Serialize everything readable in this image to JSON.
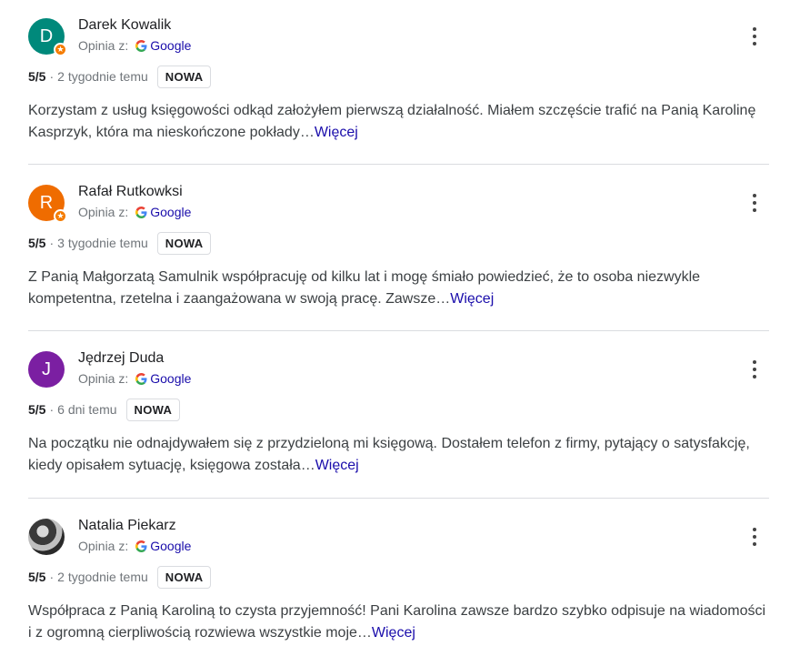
{
  "reviews": [
    {
      "avatar_letter": "D",
      "avatar_color": "#00897b",
      "badge_color": "#f57c00",
      "name": "Darek Kowalik",
      "source_label": "Opinia z:",
      "source_name": "Google",
      "rating": "5/5",
      "date": "2 tygodnie temu",
      "tag": "NOWA",
      "text": "Korzystam z usług księgowości odkąd założyłem pierwszą działalność. Miałem szczęście trafić na Panią Karolinę Kasprzyk, która ma nieskończone pokłady…",
      "more_label": "Więcej"
    },
    {
      "avatar_letter": "R",
      "avatar_color": "#ef6c00",
      "badge_color": "#f57c00",
      "name": "Rafał Rutkowksi",
      "source_label": "Opinia z:",
      "source_name": "Google",
      "rating": "5/5",
      "date": "3 tygodnie temu",
      "tag": "NOWA",
      "text": "Z Panią Małgorzatą Samulnik współpracuję od kilku lat i mogę śmiało powiedzieć, że to osoba niezwykle kompetentna, rzetelna i zaangażowana w swoją pracę. Zawsze…",
      "more_label": "Więcej"
    },
    {
      "avatar_letter": "J",
      "avatar_color": "#7b1fa2",
      "name": "Jędrzej Duda",
      "source_label": "Opinia z:",
      "source_name": "Google",
      "rating": "5/5",
      "date": "6 dni temu",
      "tag": "NOWA",
      "text": "Na początku nie odnajdywałem się z przydzieloną mi księgową. Dostałem telefon z firmy, pytający o satysfakcję, kiedy opisałem sytuację, księgowa została…",
      "more_label": "Więcej"
    },
    {
      "avatar_letter": "",
      "avatar_color": "#555555",
      "name": "Natalia Piekarz",
      "source_label": "Opinia z:",
      "source_name": "Google",
      "rating": "5/5",
      "date": "2 tygodnie temu",
      "tag": "NOWA",
      "text": "Współpraca z Panią Karoliną to czysta przyjemność! Pani Karolina zawsze bardzo szybko odpisuje na wiadomości i z ogromną cierpliwością rozwiewa wszystkie moje…",
      "more_label": "Więcej"
    }
  ],
  "icons": {
    "source": "google-g-icon",
    "menu": "more-vert-icon",
    "badge": "local-guide-star-icon"
  }
}
